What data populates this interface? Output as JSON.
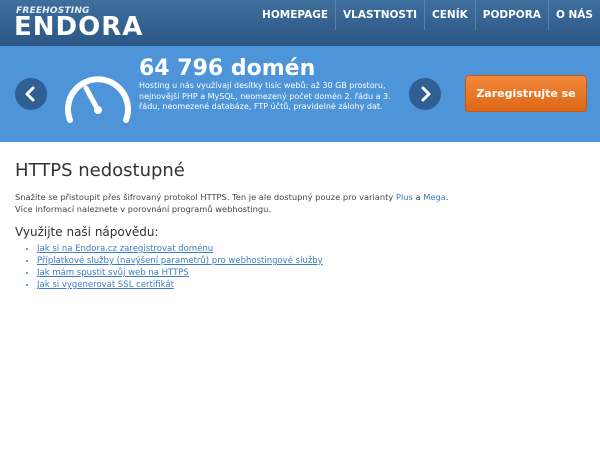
{
  "header": {
    "logo_small": "FREEHOSTING",
    "logo_big": "ENDORA",
    "nav": [
      "HOMEPAGE",
      "VLASTNOSTI",
      "CENÍK",
      "PODPORA",
      "O NÁS"
    ]
  },
  "banner": {
    "count": "64 796 domén",
    "description": "Hosting u nás využívají desítky tisíc webů: až 30 GB prostoru, nejnovější PHP a MySQL, neomezený počet domén 2. řádu a 3. řádu, neomezené databáze, FTP účtů, pravidelné zálohy dat.",
    "cta_label": "Zaregistrujte se",
    "icons": {
      "left": "chevron-left-icon",
      "right": "chevron-right-icon",
      "gauge": "speedometer-icon"
    },
    "colors": {
      "background": "#4d94d9",
      "arrow": "#2f5f93",
      "cta": "#e8741f"
    }
  },
  "main": {
    "title": "HTTPS nedostupné",
    "text_before_plus": "Snažíte se přistoupit přes šifrovaný protokol HTTPS. Ten je ale dostupný pouze pro varianty",
    "link_plus": "Plus",
    "text_and": "a",
    "link_mega": "Mega",
    "text_after": ".",
    "text_line2": "Více informací naleznete v porovnání programů webhostingu.",
    "help_title": "Využijte naši nápovědu:",
    "help_links": [
      "Jak si na Endora.cz zaregistrovat doménu",
      "Příplatkové služby (navýšení parametrů) pro webhostingové služby",
      "Jak mám spustit svůj web na HTTPS",
      "Jak si vygenerovat SSL certifikát"
    ]
  }
}
